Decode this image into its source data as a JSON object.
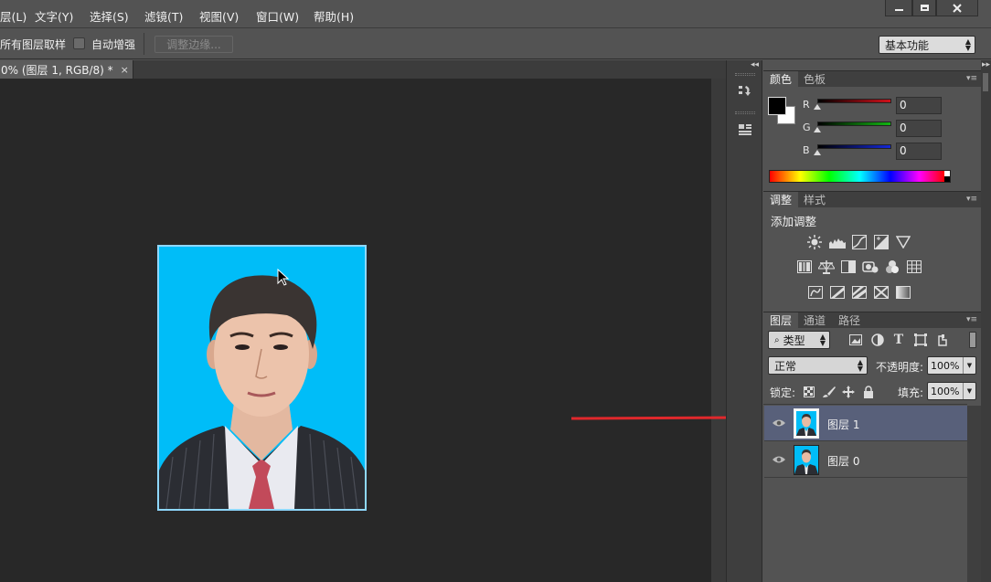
{
  "menu": {
    "items": [
      "层(L)",
      "文字(Y)",
      "选择(S)",
      "滤镜(T)",
      "视图(V)",
      "窗口(W)",
      "帮助(H)"
    ]
  },
  "options_bar": {
    "sample_all_layers": "所有图层取样",
    "auto_enhance": "自动增强",
    "refine_edge_button": "调整边缘...",
    "workspace": "基本功能"
  },
  "document": {
    "tab_title": "0% (图层 1, RGB/8) *",
    "close_glyph": "×"
  },
  "color_panel": {
    "tabs": [
      "颜色",
      "色板"
    ],
    "channels": [
      {
        "label": "R",
        "value": "0",
        "color": "#d0101a"
      },
      {
        "label": "G",
        "value": "0",
        "color": "#12b512"
      },
      {
        "label": "B",
        "value": "0",
        "color": "#1428d8"
      }
    ]
  },
  "adjust_panel": {
    "tabs": [
      "调整",
      "样式"
    ],
    "heading": "添加调整"
  },
  "layers_panel": {
    "tabs": [
      "图层",
      "通道",
      "路径"
    ],
    "filter_kind": "类型",
    "blend_mode": "正常",
    "opacity_label": "不透明度:",
    "opacity_value": "100%",
    "lock_label": "锁定:",
    "fill_label": "填充:",
    "fill_value": "100%",
    "layers": [
      {
        "name": "图层 1",
        "selected": true,
        "visible": true
      },
      {
        "name": "图层 0",
        "selected": false,
        "visible": true
      }
    ]
  },
  "colors": {
    "photo_background": "#00bdf8",
    "annotation_arrow": "#e0282c",
    "selected_layer": "#58607a"
  }
}
